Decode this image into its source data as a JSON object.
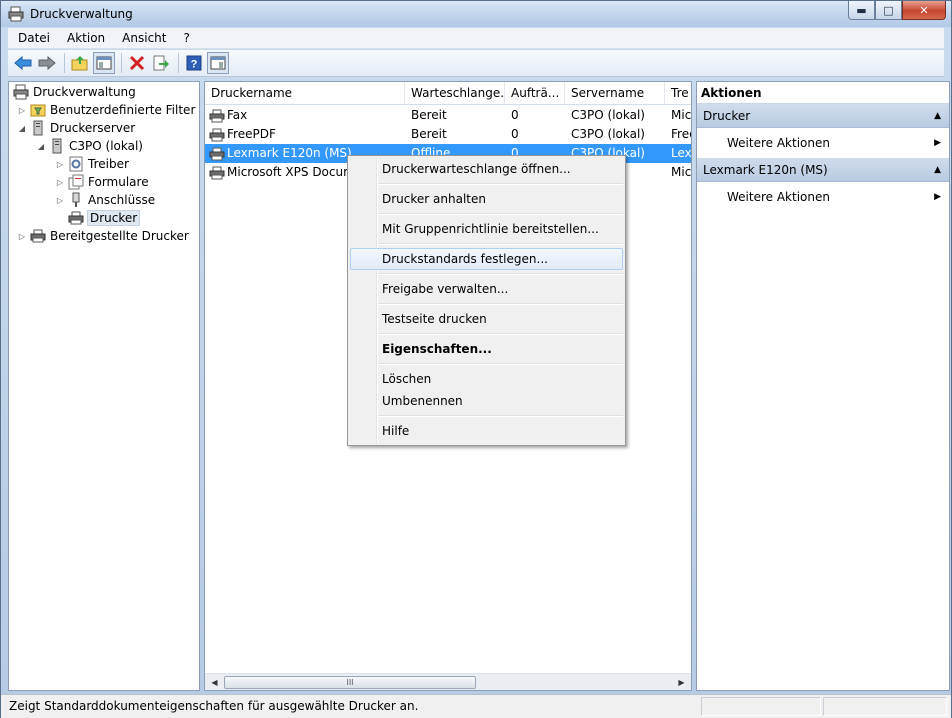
{
  "window": {
    "title": "Druckverwaltung"
  },
  "menu": [
    "Datei",
    "Aktion",
    "Ansicht",
    "?"
  ],
  "tree": [
    {
      "label": "Druckverwaltung"
    },
    {
      "label": "Benutzerdefinierte Filter"
    },
    {
      "label": "Druckerserver"
    },
    {
      "label": "C3PO (lokal)"
    },
    {
      "label": "Treiber"
    },
    {
      "label": "Formulare"
    },
    {
      "label": "Anschlüsse"
    },
    {
      "label": "Drucker"
    },
    {
      "label": "Bereitgestellte Drucker"
    }
  ],
  "list": {
    "columns": [
      "Druckername",
      "Warteschlange...",
      "Aufträ...",
      "Servername",
      "Tre"
    ],
    "rows": [
      {
        "name": "Fax",
        "status": "Bereit",
        "jobs": "0",
        "server": "C3PO (lokal)",
        "driver": "Mic"
      },
      {
        "name": "FreePDF",
        "status": "Bereit",
        "jobs": "0",
        "server": "C3PO (lokal)",
        "driver": "Free"
      },
      {
        "name": "Lexmark E120n (MS)",
        "status": "Offline",
        "jobs": "0",
        "server": "C3PO (lokal)",
        "driver": "Lex"
      },
      {
        "name": "Microsoft XPS Docume",
        "status": "",
        "jobs": "",
        "server": "al)",
        "driver": "Mic"
      }
    ],
    "selected_row": "Lexmark E120n (MS)"
  },
  "scroll": {
    "thumb_grip": "III"
  },
  "context_menu": [
    "Druckerwarteschlange öffnen...",
    "Drucker anhalten",
    "Mit Gruppenrichtlinie bereitstellen...",
    "Druckstandards festlegen...",
    "Freigabe verwalten...",
    "Testseite drucken",
    "Eigenschaften...",
    "Löschen",
    "Umbenennen",
    "Hilfe"
  ],
  "actions": {
    "title": "Aktionen",
    "groups": [
      {
        "name": "Drucker",
        "item": "Weitere Aktionen"
      },
      {
        "name": "Lexmark E120n (MS)",
        "item": "Weitere Aktionen"
      }
    ]
  },
  "status": {
    "text": "Zeigt Standarddokumenteigenschaften für ausgewählte Drucker an."
  },
  "colors": {
    "selection": "#3399ff",
    "menu_hover_border": "#aecff7",
    "action_header": "#c4d4e8"
  }
}
